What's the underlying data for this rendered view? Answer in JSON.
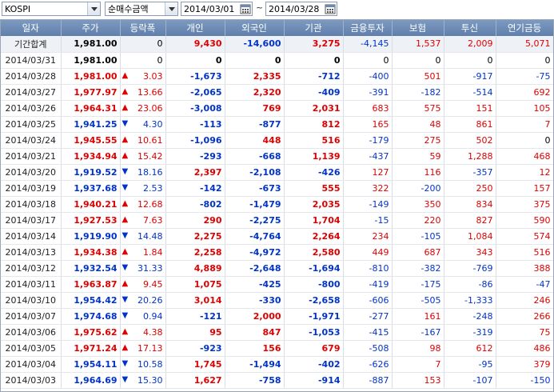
{
  "toolbar": {
    "market": "KOSPI",
    "metric": "순매수금액",
    "date_from": "2014/03/01",
    "date_to": "2014/03/28",
    "separator": "~"
  },
  "colors": {
    "up": "#e00000",
    "down": "#0033cc",
    "header_bg": "#6b89b4"
  },
  "table": {
    "headers": [
      "일자",
      "주가",
      "등락폭",
      "개인",
      "외국인",
      "기관",
      "금융투자",
      "보험",
      "투신",
      "연기금등"
    ],
    "summary": {
      "label": "기간합계",
      "price": "1,981.00",
      "change": "0",
      "individual": "9,430",
      "foreign": "-14,600",
      "institution": "3,275",
      "fin_invest": "-4,145",
      "insurance": "1,537",
      "trust": "2,009",
      "pension": "5,071"
    },
    "rows": [
      {
        "date": "2014/03/31",
        "price": "1,981.00",
        "dir": "none",
        "change": "0",
        "individual": "0",
        "foreign": "0",
        "institution": "0",
        "fin_invest": "0",
        "insurance": "0",
        "trust": "0",
        "pension": "0"
      },
      {
        "date": "2014/03/28",
        "price": "1,981.00",
        "dir": "up",
        "change": "3.03",
        "individual": "-1,673",
        "foreign": "2,335",
        "institution": "-712",
        "fin_invest": "-400",
        "insurance": "501",
        "trust": "-917",
        "pension": "-75"
      },
      {
        "date": "2014/03/27",
        "price": "1,977.97",
        "dir": "up",
        "change": "13.66",
        "individual": "-2,065",
        "foreign": "2,320",
        "institution": "-409",
        "fin_invest": "-391",
        "insurance": "-182",
        "trust": "-514",
        "pension": "692"
      },
      {
        "date": "2014/03/26",
        "price": "1,964.31",
        "dir": "up",
        "change": "23.06",
        "individual": "-3,008",
        "foreign": "769",
        "institution": "2,031",
        "fin_invest": "683",
        "insurance": "575",
        "trust": "151",
        "pension": "105"
      },
      {
        "date": "2014/03/25",
        "price": "1,941.25",
        "dir": "down",
        "change": "4.30",
        "individual": "-113",
        "foreign": "-877",
        "institution": "812",
        "fin_invest": "165",
        "insurance": "48",
        "trust": "861",
        "pension": "7"
      },
      {
        "date": "2014/03/24",
        "price": "1,945.55",
        "dir": "up",
        "change": "10.61",
        "individual": "-1,096",
        "foreign": "448",
        "institution": "516",
        "fin_invest": "-179",
        "insurance": "275",
        "trust": "502",
        "pension": "0"
      },
      {
        "date": "2014/03/21",
        "price": "1,934.94",
        "dir": "up",
        "change": "15.42",
        "individual": "-293",
        "foreign": "-668",
        "institution": "1,139",
        "fin_invest": "-437",
        "insurance": "59",
        "trust": "1,288",
        "pension": "468"
      },
      {
        "date": "2014/03/20",
        "price": "1,919.52",
        "dir": "down",
        "change": "18.16",
        "individual": "2,397",
        "foreign": "-2,108",
        "institution": "-426",
        "fin_invest": "127",
        "insurance": "116",
        "trust": "-357",
        "pension": "12"
      },
      {
        "date": "2014/03/19",
        "price": "1,937.68",
        "dir": "down",
        "change": "2.53",
        "individual": "-142",
        "foreign": "-673",
        "institution": "555",
        "fin_invest": "322",
        "insurance": "-200",
        "trust": "250",
        "pension": "157"
      },
      {
        "date": "2014/03/18",
        "price": "1,940.21",
        "dir": "up",
        "change": "12.68",
        "individual": "-802",
        "foreign": "-1,479",
        "institution": "2,035",
        "fin_invest": "-149",
        "insurance": "350",
        "trust": "834",
        "pension": "375"
      },
      {
        "date": "2014/03/17",
        "price": "1,927.53",
        "dir": "up",
        "change": "7.63",
        "individual": "290",
        "foreign": "-2,275",
        "institution": "1,704",
        "fin_invest": "-15",
        "insurance": "220",
        "trust": "827",
        "pension": "590"
      },
      {
        "date": "2014/03/14",
        "price": "1,919.90",
        "dir": "down",
        "change": "14.48",
        "individual": "2,275",
        "foreign": "-4,764",
        "institution": "2,264",
        "fin_invest": "234",
        "insurance": "-105",
        "trust": "1,084",
        "pension": "574"
      },
      {
        "date": "2014/03/13",
        "price": "1,934.38",
        "dir": "up",
        "change": "1.84",
        "individual": "2,258",
        "foreign": "-4,972",
        "institution": "2,580",
        "fin_invest": "449",
        "insurance": "687",
        "trust": "343",
        "pension": "516"
      },
      {
        "date": "2014/03/12",
        "price": "1,932.54",
        "dir": "down",
        "change": "31.33",
        "individual": "4,889",
        "foreign": "-2,648",
        "institution": "-1,694",
        "fin_invest": "-810",
        "insurance": "-382",
        "trust": "-769",
        "pension": "388"
      },
      {
        "date": "2014/03/11",
        "price": "1,963.87",
        "dir": "up",
        "change": "9.45",
        "individual": "1,075",
        "foreign": "-425",
        "institution": "-800",
        "fin_invest": "-419",
        "insurance": "-175",
        "trust": "-86",
        "pension": "-47"
      },
      {
        "date": "2014/03/10",
        "price": "1,954.42",
        "dir": "down",
        "change": "20.26",
        "individual": "3,014",
        "foreign": "-330",
        "institution": "-2,658",
        "fin_invest": "-606",
        "insurance": "-505",
        "trust": "-1,333",
        "pension": "246"
      },
      {
        "date": "2014/03/07",
        "price": "1,974.68",
        "dir": "down",
        "change": "0.94",
        "individual": "-121",
        "foreign": "2,000",
        "institution": "-1,971",
        "fin_invest": "-277",
        "insurance": "161",
        "trust": "-248",
        "pension": "266"
      },
      {
        "date": "2014/03/06",
        "price": "1,975.62",
        "dir": "up",
        "change": "4.38",
        "individual": "95",
        "foreign": "847",
        "institution": "-1,053",
        "fin_invest": "-415",
        "insurance": "-167",
        "trust": "-319",
        "pension": "75"
      },
      {
        "date": "2014/03/05",
        "price": "1,971.24",
        "dir": "up",
        "change": "17.13",
        "individual": "-923",
        "foreign": "156",
        "institution": "679",
        "fin_invest": "-508",
        "insurance": "98",
        "trust": "612",
        "pension": "486"
      },
      {
        "date": "2014/03/04",
        "price": "1,954.11",
        "dir": "down",
        "change": "10.58",
        "individual": "1,745",
        "foreign": "-1,494",
        "institution": "-402",
        "fin_invest": "-626",
        "insurance": "7",
        "trust": "-95",
        "pension": "379"
      },
      {
        "date": "2014/03/03",
        "price": "1,964.69",
        "dir": "down",
        "change": "15.30",
        "individual": "1,627",
        "foreign": "-758",
        "institution": "-914",
        "fin_invest": "-887",
        "insurance": "153",
        "trust": "-107",
        "pension": "-150"
      }
    ]
  }
}
